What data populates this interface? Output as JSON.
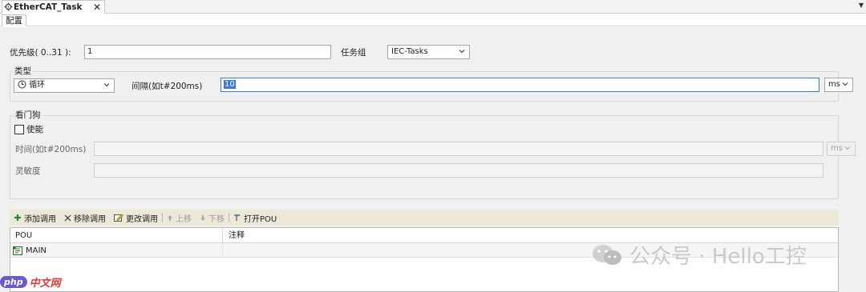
{
  "editor": {
    "tab_title": "EtherCAT_Task",
    "close_glyph": "✕",
    "subtab": "配置"
  },
  "priority": {
    "label": "优先级( 0..31 ):",
    "value": "1",
    "task_group_label": "任务组",
    "task_group_value": "IEC-Tasks"
  },
  "type_group": {
    "title": "类型",
    "type_value": "循环",
    "interval_label": "间隔(如t#200ms)",
    "interval_value": "10",
    "unit_value": "ms"
  },
  "watchdog": {
    "title": "看门狗",
    "enable_label": "使能",
    "enabled": false,
    "time_label": "时间(如t#200ms)",
    "time_value": "",
    "time_unit": "ms",
    "sensitivity_label": "灵敏度",
    "sensitivity_value": ""
  },
  "toolbar": {
    "add_call": "添加调用",
    "remove_call": "移除调用",
    "change_call": "更改调用",
    "move_up": "上移",
    "move_down": "下移",
    "open_pou": "打开POU"
  },
  "calls_table": {
    "columns": [
      "POU",
      "注释"
    ],
    "rows": [
      {
        "pou": "MAIN",
        "comment": ""
      }
    ]
  },
  "overlays": {
    "watermark_text": "公众号 · Hello工控",
    "php_logo_php": "php",
    "php_logo_cn": "中文网"
  },
  "icons": {
    "task": "task-gear-icon",
    "cyclic": "clock-icon",
    "add": "plus-icon",
    "remove": "x-icon",
    "change": "edit-icon",
    "up": "arrow-up-icon",
    "down": "arrow-down-icon",
    "open": "open-pou-icon",
    "program": "program-icon"
  },
  "colors": {
    "accent": "#3b7bd6",
    "panel_bg": "#f0f0f0",
    "toolbar_bg": "#ece9d8",
    "add_green": "#2a8a2a",
    "php_purple": "#6a5acd",
    "php_red": "#e53935"
  }
}
